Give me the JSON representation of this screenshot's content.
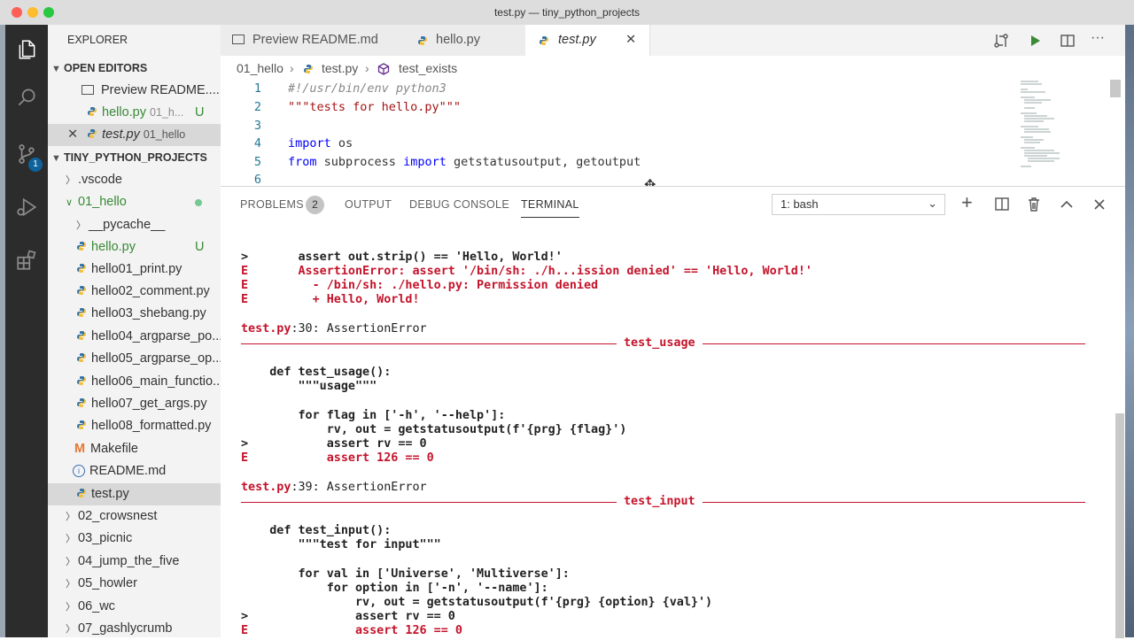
{
  "window": {
    "title": "test.py — tiny_python_projects"
  },
  "colors": {
    "accent": "#0e639c",
    "error": "#c4142b",
    "untracked": "#388a34"
  },
  "activity": {
    "source_control_badge": "1"
  },
  "sidebar": {
    "explorer_title": "EXPLORER",
    "open_editors": {
      "title": "OPEN EDITORS",
      "items": [
        {
          "label": "Preview README....",
          "dir": "",
          "status": ""
        },
        {
          "label": "hello.py",
          "dir": "01_h...",
          "status": "U"
        },
        {
          "label": "test.py",
          "dir": "01_hello",
          "status": ""
        }
      ]
    },
    "project": {
      "title": "TINY_PYTHON_PROJECTS",
      "items": [
        {
          "label": ".vscode"
        },
        {
          "label": "01_hello"
        },
        {
          "label": "__pycache__"
        },
        {
          "label": "hello.py",
          "status": "U"
        },
        {
          "label": "hello01_print.py"
        },
        {
          "label": "hello02_comment.py"
        },
        {
          "label": "hello03_shebang.py"
        },
        {
          "label": "hello04_argparse_po..."
        },
        {
          "label": "hello05_argparse_op..."
        },
        {
          "label": "hello06_main_functio..."
        },
        {
          "label": "hello07_get_args.py"
        },
        {
          "label": "hello08_formatted.py"
        },
        {
          "label": "Makefile"
        },
        {
          "label": "README.md"
        },
        {
          "label": "test.py"
        },
        {
          "label": "02_crowsnest"
        },
        {
          "label": "03_picnic"
        },
        {
          "label": "04_jump_the_five"
        },
        {
          "label": "05_howler"
        },
        {
          "label": "06_wc"
        },
        {
          "label": "07_gashlycrumb"
        }
      ]
    }
  },
  "tabs": [
    {
      "label": "Preview README.md"
    },
    {
      "label": "hello.py"
    },
    {
      "label": "test.py"
    }
  ],
  "breadcrumb": {
    "folder": "01_hello",
    "file": "test.py",
    "symbol": "test_exists"
  },
  "editor": {
    "lines": [
      {
        "n": "1",
        "shebang": "#!/usr/bin/env python3"
      },
      {
        "n": "2",
        "docstring": "\"\"\"tests for hello.py\"\"\""
      },
      {
        "n": "3"
      },
      {
        "n": "4",
        "kw": "import",
        "rest": " os"
      },
      {
        "n": "5",
        "kw": "from",
        "mod": " subprocess ",
        "kw2": "import",
        "rest": " getstatusoutput, getoutput"
      },
      {
        "n": "6"
      }
    ]
  },
  "panel": {
    "tabs": {
      "problems": "PROBLEMS",
      "problems_count": "2",
      "output": "OUTPUT",
      "debug_console": "DEBUG CONSOLE",
      "terminal": "TERMINAL"
    },
    "terminal_select": "1: bash",
    "terminal_lines": {
      "l1": ">       assert out.strip() == 'Hello, World!'",
      "l2": "E       AssertionError: assert '/bin/sh: ./h...ission denied' == 'Hello, World!'",
      "l3": "E         - /bin/sh: ./hello.py: Permission denied",
      "l4": "E         + Hello, World!",
      "l5_file": "test.py",
      "l5_rest": ":30: AssertionError",
      "sep1": "test_usage",
      "l6": "    def test_usage():",
      "l7": "        \"\"\"usage\"\"\"",
      "l8": "        for flag in ['-h', '--help']:",
      "l9": "            rv, out = getstatusoutput(f'{prg} {flag}')",
      "l10": ">           assert rv == 0",
      "l11": "E           assert 126 == 0",
      "l12_file": "test.py",
      "l12_rest": ":39: AssertionError",
      "sep2": "test_input",
      "l13": "    def test_input():",
      "l14": "        \"\"\"test for input\"\"\"",
      "l15": "        for val in ['Universe', 'Multiverse']:",
      "l16": "            for option in ['-n', '--name']:",
      "l17": "                rv, out = getstatusoutput(f'{prg} {option} {val}')",
      "l18": ">               assert rv == 0",
      "l19": "E               assert 126 == 0"
    }
  }
}
